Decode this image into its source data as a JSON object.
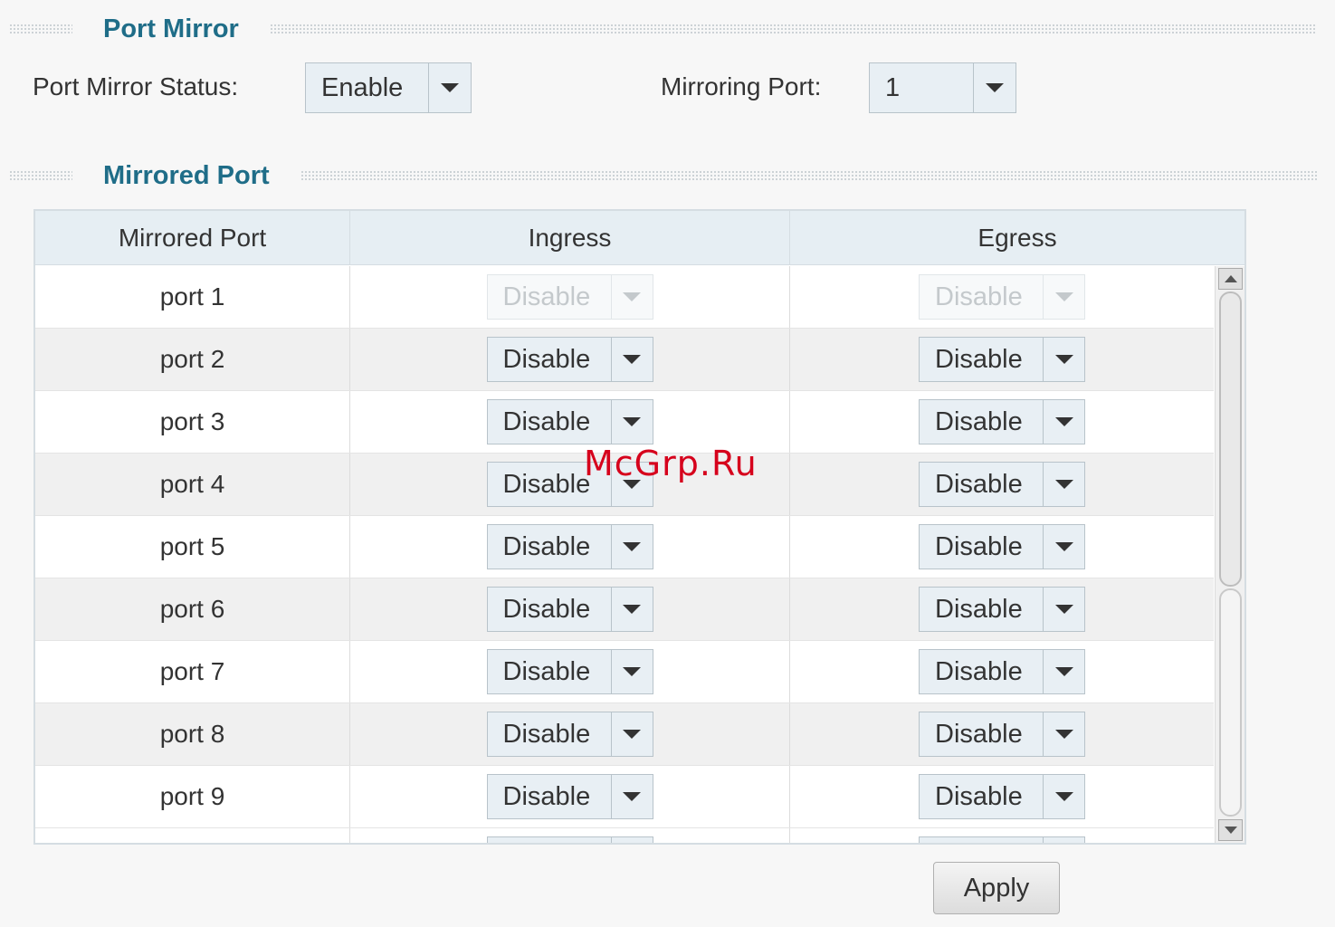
{
  "port_mirror": {
    "title": "Port Mirror",
    "status_label": "Port Mirror Status:",
    "status_value": "Enable",
    "mirroring_port_label": "Mirroring Port:",
    "mirroring_port_value": "1"
  },
  "mirrored_port_section": {
    "title": "Mirrored Port"
  },
  "table": {
    "headers": [
      "Mirrored Port",
      "Ingress",
      "Egress"
    ],
    "rows": [
      {
        "port": "port 1",
        "ingress": "Disable",
        "egress": "Disable",
        "disabled": true
      },
      {
        "port": "port 2",
        "ingress": "Disable",
        "egress": "Disable",
        "disabled": false
      },
      {
        "port": "port 3",
        "ingress": "Disable",
        "egress": "Disable",
        "disabled": false
      },
      {
        "port": "port 4",
        "ingress": "Disable",
        "egress": "Disable",
        "disabled": false
      },
      {
        "port": "port 5",
        "ingress": "Disable",
        "egress": "Disable",
        "disabled": false
      },
      {
        "port": "port 6",
        "ingress": "Disable",
        "egress": "Disable",
        "disabled": false
      },
      {
        "port": "port 7",
        "ingress": "Disable",
        "egress": "Disable",
        "disabled": false
      },
      {
        "port": "port 8",
        "ingress": "Disable",
        "egress": "Disable",
        "disabled": false
      },
      {
        "port": "port 9",
        "ingress": "Disable",
        "egress": "Disable",
        "disabled": false
      }
    ]
  },
  "apply_label": "Apply",
  "watermark": "McGrp.Ru",
  "colors": {
    "section_title": "#1f6d88",
    "watermark": "#d6001c"
  }
}
